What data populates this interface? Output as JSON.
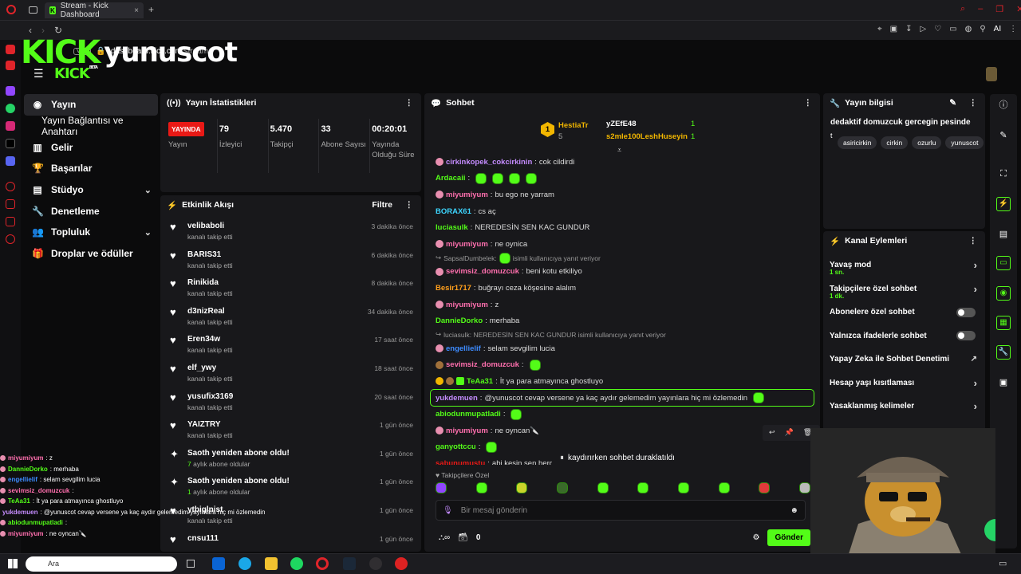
{
  "browser": {
    "tab_title": "Stream - Kick Dashboard",
    "vpn": "VPN",
    "url_domain": "dashboard.kick.com",
    "url_path": "/stream",
    "ai_label": "AI"
  },
  "brand": {
    "kick_big": "KICK",
    "username": "yunuscot",
    "kick_small": "KICK",
    "beta": "BETA",
    "color": "#53fc18"
  },
  "nav": {
    "items": [
      {
        "label": "Yayın",
        "icon": "play-circle-icon",
        "active": true
      },
      {
        "label": "Yayın Bağlantısı ve Anahtarı",
        "sub": true
      },
      {
        "label": "Gelir",
        "icon": "chart-icon"
      },
      {
        "label": "Başarılar",
        "icon": "trophy-icon"
      },
      {
        "label": "Stüdyo",
        "icon": "studio-icon",
        "expandable": true
      },
      {
        "label": "Denetleme",
        "icon": "wrench-icon"
      },
      {
        "label": "Topluluk",
        "icon": "community-icon",
        "expandable": true
      },
      {
        "label": "Droplar ve ödüller",
        "icon": "gift-icon"
      }
    ]
  },
  "stats": {
    "title": "Yayın İstatistikleri",
    "live_badge": "YAYINDA",
    "items": [
      {
        "value": "",
        "label": "Yayın"
      },
      {
        "value": "79",
        "label": "İzleyici"
      },
      {
        "value": "5.470",
        "label": "Takipçi"
      },
      {
        "value": "33",
        "label": "Abone Sayısı"
      },
      {
        "value": "00:20:01",
        "label": "Yayında Olduğu Süre"
      }
    ]
  },
  "activity": {
    "title": "Etkinlik Akışı",
    "filter": "Filtre",
    "items": [
      {
        "name": "velibaboli",
        "sub": "kanalı takip etti",
        "time": "3 dakika önce",
        "type": "follow"
      },
      {
        "name": "BARIS31",
        "sub": "kanalı takip etti",
        "time": "6 dakika önce",
        "type": "follow"
      },
      {
        "name": "Rinikida",
        "sub": "kanalı takip etti",
        "time": "8 dakika önce",
        "type": "follow"
      },
      {
        "name": "d3nizReal",
        "sub": "kanalı takip etti",
        "time": "34 dakika önce",
        "type": "follow"
      },
      {
        "name": "Eren34w",
        "sub": "kanalı takip etti",
        "time": "17 saat önce",
        "type": "follow"
      },
      {
        "name": "elf_ywy",
        "sub": "kanalı takip etti",
        "time": "18 saat önce",
        "type": "follow"
      },
      {
        "name": "yusufix3169",
        "sub": "kanalı takip etti",
        "time": "20 saat önce",
        "type": "follow"
      },
      {
        "name": "YAIZTRY",
        "sub": "kanalı takip etti",
        "time": "1 gün önce",
        "type": "follow"
      },
      {
        "name": "Saoth yeniden abone oldu!",
        "sub_num": "7",
        "sub": " aylık abone oldular",
        "time": "1 gün önce",
        "type": "sub"
      },
      {
        "name": "Saoth yeniden abone oldu!",
        "sub_num": "1",
        "sub": " aylık abone oldular",
        "time": "1 gün önce",
        "type": "sub"
      },
      {
        "name": "ytbiglnist",
        "sub": "kanalı takip etti",
        "time": "1 gün önce",
        "type": "follow"
      },
      {
        "name": "cnsu111",
        "sub": "",
        "time": "1 gün önce",
        "type": "follow"
      }
    ]
  },
  "chat": {
    "title": "Sohbet",
    "top_gifters": [
      {
        "rank": "1",
        "name": "HestiaTr",
        "count": "5"
      },
      {
        "name": "yZEfE48",
        "count": "1"
      },
      {
        "name": "s2mle100LeshHuseyin",
        "count": "1"
      }
    ],
    "messages": [
      {
        "user": "cirkinkopek_cokcirkinin",
        "text": "cok cildirdi",
        "color": "#c58cff",
        "badge": "pink"
      },
      {
        "user": "Ardacaii",
        "text": "",
        "color": "#53fc18",
        "emotes": 4
      },
      {
        "user": "miyumiyum",
        "text": "bu ego ne yarram",
        "color": "#ff6fae",
        "badge": "pink"
      },
      {
        "user": "BORAX61",
        "text": "cs aç",
        "color": "#3dd6ff"
      },
      {
        "user": "luciasulk",
        "text": "NEREDESİN SEN KAC GUNDUR",
        "color": "#53fc18"
      },
      {
        "user": "miyumiyum",
        "text": "ne oynica",
        "color": "#ff6fae",
        "badge": "pink"
      },
      {
        "reply": "SapsalDumbelek: ",
        "reply_after": " isimli kullanıcıya yanıt veriyor",
        "reply_emote": true
      },
      {
        "user": "sevimsiz_domuzcuk",
        "text": "beni kotu etkiliyo",
        "color": "#ff6fae",
        "badge": "pink"
      },
      {
        "user": "Besir1717",
        "text": "buğrayı ceza köşesine alalım",
        "color": "#ff9f1c"
      },
      {
        "user": "miyumiyum",
        "text": "z",
        "color": "#ff6fae",
        "badge": "pink"
      },
      {
        "user": "DannieDorko",
        "text": "merhaba",
        "color": "#53fc18"
      },
      {
        "reply": "luciasulk: NEREDESİN SEN KAC GUNDUR isimli kullanıcıya yanıt veriyor"
      },
      {
        "user": "engellielif",
        "text": "selam sevgilim lucia",
        "color": "#3d8bff",
        "badge": "pink"
      },
      {
        "user": "sevimsiz_domuzcuk",
        "text": "",
        "color": "#ff6fae",
        "badge": "brown",
        "emotes": 1
      },
      {
        "user": "TeAa31",
        "text": "İt ya para atmayınca ghostluyo",
        "color": "#53fc18",
        "badges3": true
      },
      {
        "user": "yukdemuen",
        "text": "@yunuscot cevap versene ya kaç aydır gelemedim yayınlara hiç mi özlemedin",
        "color": "#c58cff",
        "highlight": true,
        "emotes": 1
      },
      {
        "user": "abiodunmupatladi",
        "text": "",
        "color": "#53fc18",
        "emotes": 1
      },
      {
        "user": "miyumiyum",
        "text": "ne oyncan🔪",
        "color": "#ff6fae",
        "badge": "pink"
      },
      {
        "user": "ganyottccu",
        "text": "",
        "color": "#53fc18",
        "emotes": 1
      },
      {
        "user": "sabunumustu",
        "text": "abi kesin sen hergün",
        "color": "#e91916"
      }
    ],
    "paused": "kaydırırken sohbet duraklatıldı",
    "followers_only_label": "Takipçilere Özel",
    "input_placeholder": "Bir mesaj gönderin",
    "points": "0",
    "send": "Gönder"
  },
  "info": {
    "title": "Yayın bilgisi",
    "stream_title": "dedaktif domuzcuk gercegin pesinde",
    "category": "t",
    "tags": [
      "asiricirkin",
      "cirkin",
      "ozurlu",
      "yunuscot"
    ]
  },
  "channel_actions": {
    "title": "Kanal Eylemleri",
    "items": [
      {
        "label": "Yavaş mod",
        "sub": "1 sn.",
        "control": "chevron"
      },
      {
        "label": "Takipçilere özel sohbet",
        "sub": "1 dk.",
        "control": "chevron"
      },
      {
        "label": "Abonelere özel sohbet",
        "control": "toggle"
      },
      {
        "label": "Yalnızca ifadelerle sohbet",
        "control": "toggle"
      },
      {
        "label": "Yapay Zeka ile Sohbet Denetimi",
        "control": "external"
      },
      {
        "label": "Hesap yaşı kısıtlaması",
        "control": "chevron"
      },
      {
        "label": "Yasaklanmış kelimeler",
        "control": "chevron"
      }
    ]
  },
  "overlay": {
    "lines": [
      {
        "user": "miyumiyum",
        "text": " : z",
        "color": "#ff6fae"
      },
      {
        "user": "DannieDorko",
        "text": " : merhaba",
        "color": "#53fc18"
      },
      {
        "user": "engellielif",
        "text": " : selam sevgilim lucia",
        "color": "#3d8bff"
      },
      {
        "user": "sevimsiz_domuzcuk",
        "text": " :",
        "color": "#ff6fae"
      },
      {
        "user": "TeAa31",
        "text": " : İt ya para atmayınca ghostluyo",
        "color": "#53fc18"
      },
      {
        "user": "yukdemuen",
        "text": " : @yunuscot cevap versene ya kaç aydır gelemedim yayınlara hiç mi özlemedin",
        "color": "#c58cff"
      },
      {
        "user": "abiodunmupatladi",
        "text": " :",
        "color": "#53fc18"
      },
      {
        "user": "miyumiyum",
        "text": " : ne oyncan🔪",
        "color": "#ff6fae"
      }
    ]
  },
  "taskbar": {
    "search": "Ara"
  }
}
